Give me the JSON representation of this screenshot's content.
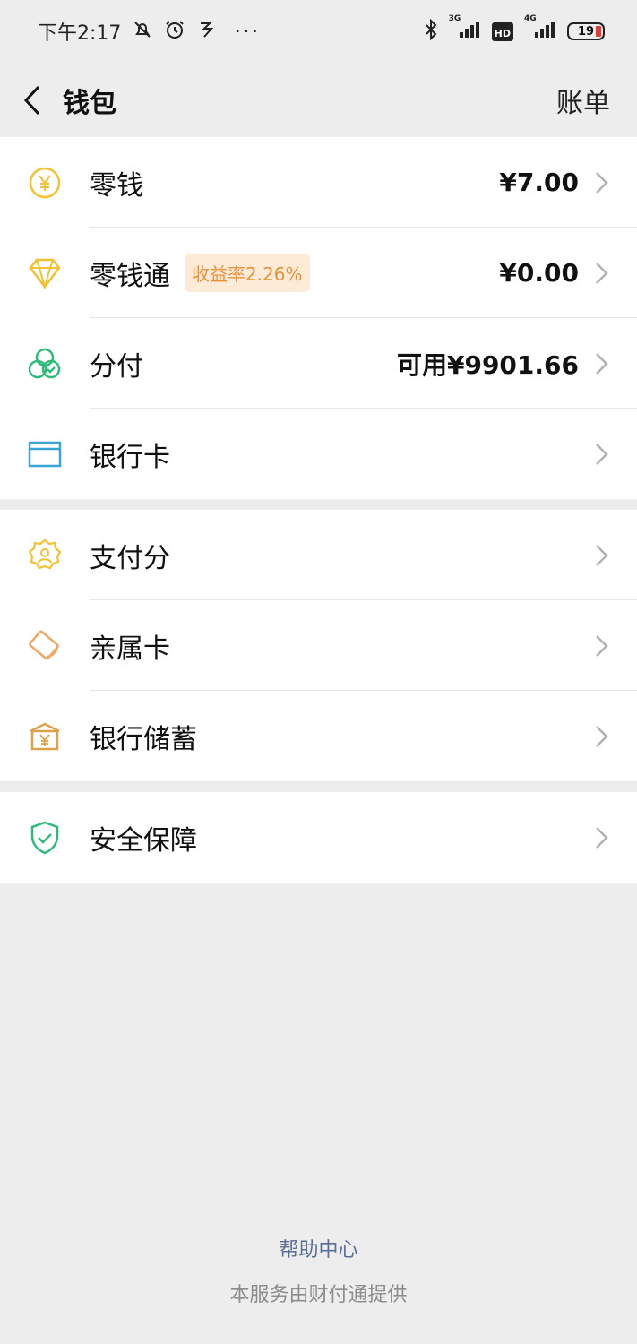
{
  "status_bar": {
    "time": "下午2:17",
    "net1": "3G",
    "hd": "HD",
    "net2": "4G",
    "battery": "19",
    "dots": "···"
  },
  "nav": {
    "title": "钱包",
    "right_label": "账单"
  },
  "group1": [
    {
      "label": "零钱",
      "value": "¥7.00",
      "icon": "yuan-coin-icon",
      "color": "#f2c230"
    },
    {
      "label": "零钱通",
      "badge": "收益率2.26%",
      "value": "¥0.00",
      "icon": "diamond-icon",
      "color": "#f2c230"
    },
    {
      "label": "分付",
      "value": "可用¥9901.66",
      "icon": "circles-check-icon",
      "color": "#2dbb7a"
    },
    {
      "label": "银行卡",
      "value": "",
      "icon": "bank-card-icon",
      "color": "#3aa3d8"
    }
  ],
  "group2": [
    {
      "label": "支付分",
      "icon": "pay-score-badge-icon",
      "color": "#f2c230"
    },
    {
      "label": "亲属卡",
      "icon": "family-card-icon",
      "color": "#f0a860"
    },
    {
      "label": "银行储蓄",
      "icon": "bank-savings-icon",
      "color": "#e0a14a"
    }
  ],
  "group3": [
    {
      "label": "安全保障",
      "icon": "shield-check-icon",
      "color": "#2dbb7a"
    }
  ],
  "footer": {
    "help": "帮助中心",
    "provider": "本服务由财付通提供"
  }
}
